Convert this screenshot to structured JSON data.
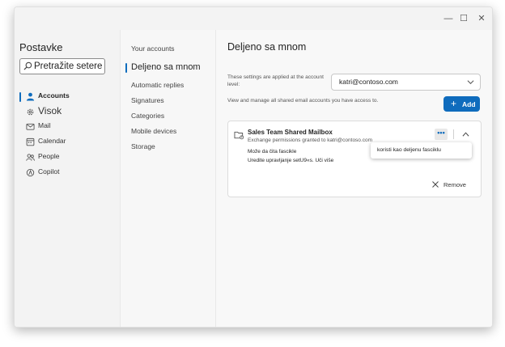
{
  "window": {
    "controls": {
      "minimize": "—",
      "maximize": "☐",
      "close": "✕"
    }
  },
  "left_nav": {
    "title": "Postavke",
    "search": {
      "placeholder": "Pretražite setere",
      "value": ""
    },
    "items": [
      {
        "label": "Accounts",
        "icon": "person-icon",
        "active": true
      },
      {
        "label": "Visok",
        "icon": "gear-icon"
      },
      {
        "label": "Mail",
        "icon": "mail-icon"
      },
      {
        "label": "Calendar",
        "icon": "calendar-icon"
      },
      {
        "label": "People",
        "icon": "people-icon"
      },
      {
        "label": "Copilot",
        "icon": "copilot-icon"
      }
    ]
  },
  "mid_nav": {
    "items": [
      {
        "label": "Your accounts"
      },
      {
        "label": "Deljeno sa mnom",
        "active": true
      },
      {
        "label": "Automatic replies"
      },
      {
        "label": "Signatures"
      },
      {
        "label": "Categories"
      },
      {
        "label": "Mobile devices"
      },
      {
        "label": "Storage"
      }
    ]
  },
  "main": {
    "title": "Deljeno sa mnom",
    "account_note": "These settings are applied at the account level:",
    "account_select": {
      "value": "katri@contoso.com"
    },
    "manage_note": "View and manage all shared email accounts you have access to.",
    "add_label": "Add",
    "mailbox": {
      "name": "Sales Team Shared Mailbox",
      "subtitle": "Exchange permissions granted to katri@contoso.com",
      "permission_line1": "Može da čita fascikle",
      "permission_line2": "Uredite upravljanje setU9«s. Uči više",
      "more_label": "•••",
      "remove_label": "Remove"
    },
    "tooltip": "koristi kao deljenu fasciklu"
  },
  "colors": {
    "accent": "#0f6cbd"
  }
}
